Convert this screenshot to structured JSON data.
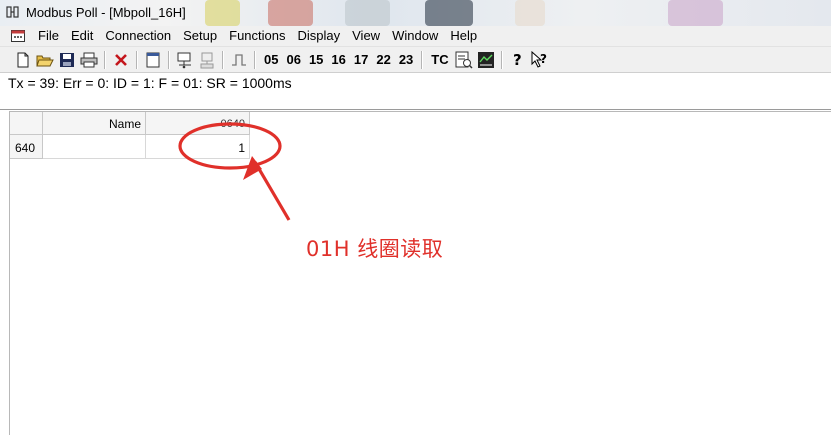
{
  "window": {
    "title": "Modbus Poll - [Mbpoll_16H]"
  },
  "menu": {
    "items": [
      "File",
      "Edit",
      "Connection",
      "Setup",
      "Functions",
      "Display",
      "View",
      "Window",
      "Help"
    ]
  },
  "toolbar": {
    "icons": [
      "new-document-icon",
      "open-folder-icon",
      "save-icon",
      "print-icon",
      "delete-icon",
      "window-icon",
      "connect-icon",
      "disconnect-icon",
      "pulse-icon",
      "help-icon",
      "whats-this-icon"
    ],
    "function_codes": [
      "05",
      "06",
      "15",
      "16",
      "17",
      "22",
      "23"
    ],
    "tc_label": "TC"
  },
  "status": {
    "text": "Tx = 39: Err = 0: ID = 1: F = 01: SR = 1000ms"
  },
  "grid": {
    "name_header": "Name",
    "address_header": "0640",
    "row_label": "640",
    "row_name": "",
    "row_value": "1"
  },
  "annotation": {
    "text": "01H 线圈读取",
    "color": "#e0302a"
  }
}
